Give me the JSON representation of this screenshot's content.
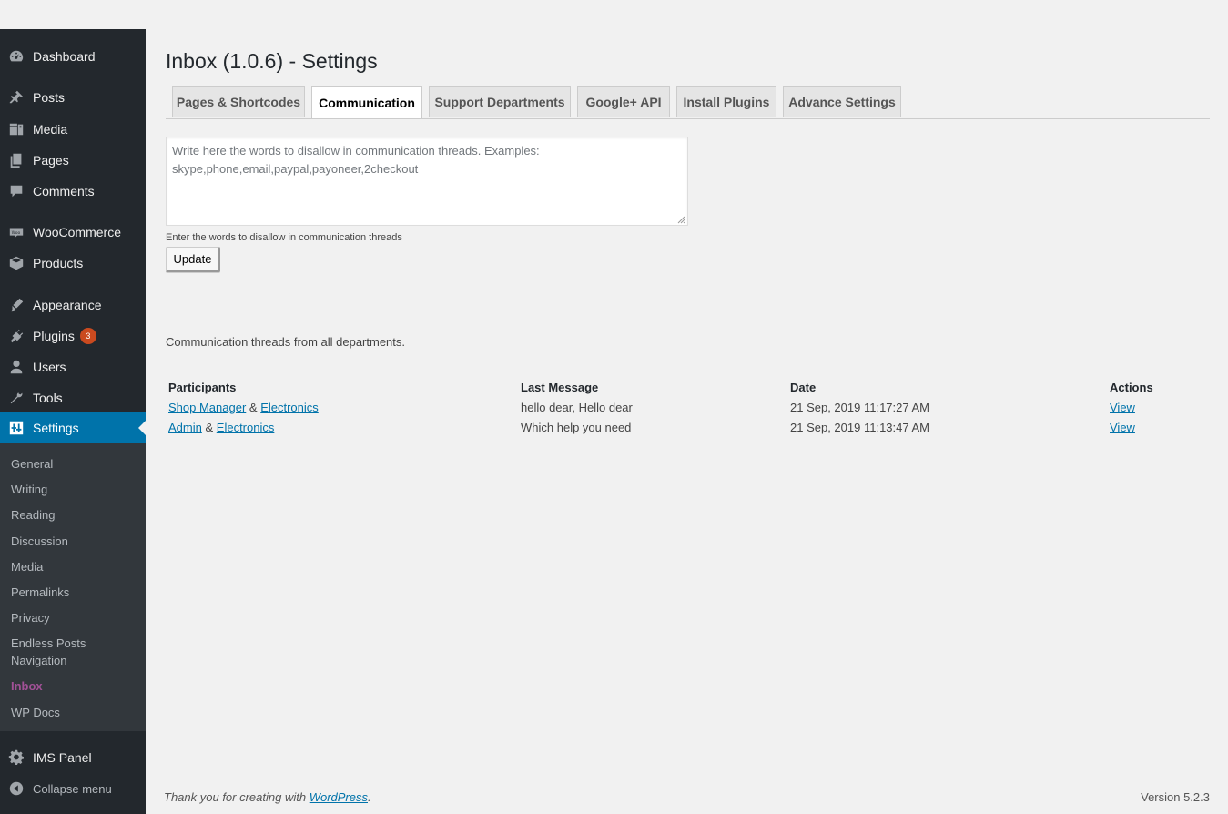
{
  "sidebar": {
    "items": [
      {
        "label": "Dashboard",
        "icon": "dashboard-icon"
      },
      {
        "label": "Posts",
        "icon": "pin-icon"
      },
      {
        "label": "Media",
        "icon": "media-icon"
      },
      {
        "label": "Pages",
        "icon": "pages-icon"
      },
      {
        "label": "Comments",
        "icon": "comment-icon"
      },
      {
        "label": "WooCommerce",
        "icon": "woo-icon"
      },
      {
        "label": "Products",
        "icon": "box-icon"
      },
      {
        "label": "Appearance",
        "icon": "brush-icon"
      },
      {
        "label": "Plugins",
        "icon": "plugin-icon",
        "badge": "3"
      },
      {
        "label": "Users",
        "icon": "user-icon"
      },
      {
        "label": "Tools",
        "icon": "wrench-icon"
      },
      {
        "label": "Settings",
        "icon": "settings-icon"
      },
      {
        "label": "IMS Panel",
        "icon": "gear-icon"
      },
      {
        "label": "Collapse menu",
        "icon": "collapse-icon"
      }
    ],
    "submenu": [
      "General",
      "Writing",
      "Reading",
      "Discussion",
      "Media",
      "Permalinks",
      "Privacy",
      "Endless Posts Navigation",
      "Inbox",
      "WP Docs"
    ]
  },
  "page": {
    "title": "Inbox (1.0.6) - Settings",
    "tabs": [
      "Pages & Shortcodes",
      "Communication",
      "Support Departments",
      "Google+ API",
      "Install Plugins",
      "Advance Settings"
    ],
    "textarea_placeholder": "Write here the words to disallow in communication threads. Examples: skype,phone,email,paypal,payoneer,2checkout",
    "textarea_description": "Enter the words to disallow in communication threads",
    "update_label": "Update",
    "threads_info": "Communication threads from all departments."
  },
  "table": {
    "headers": [
      "Participants",
      "Last Message",
      "Date",
      "Actions"
    ],
    "rows": [
      {
        "p1": "Shop Manager",
        "amp": "&",
        "p2": "Electronics",
        "message": "hello dear, Hello dear",
        "date": "21 Sep, 2019 11:17:27 AM",
        "action": "View"
      },
      {
        "p1": "Admin",
        "amp": "&",
        "p2": "Electronics",
        "message": "Which help you need",
        "date": "21 Sep, 2019 11:13:47 AM",
        "action": "View"
      }
    ]
  },
  "footer": {
    "thanks_prefix": "Thank you for creating with ",
    "thanks_link": "WordPress",
    "thanks_suffix": ".",
    "version": "Version 5.2.3"
  },
  "colors": {
    "sidebar_bg": "#23282d",
    "submenu_bg": "#32373c",
    "accent": "#0073aa",
    "current_sub": "#a15196",
    "badge": "#ca4a1f"
  }
}
